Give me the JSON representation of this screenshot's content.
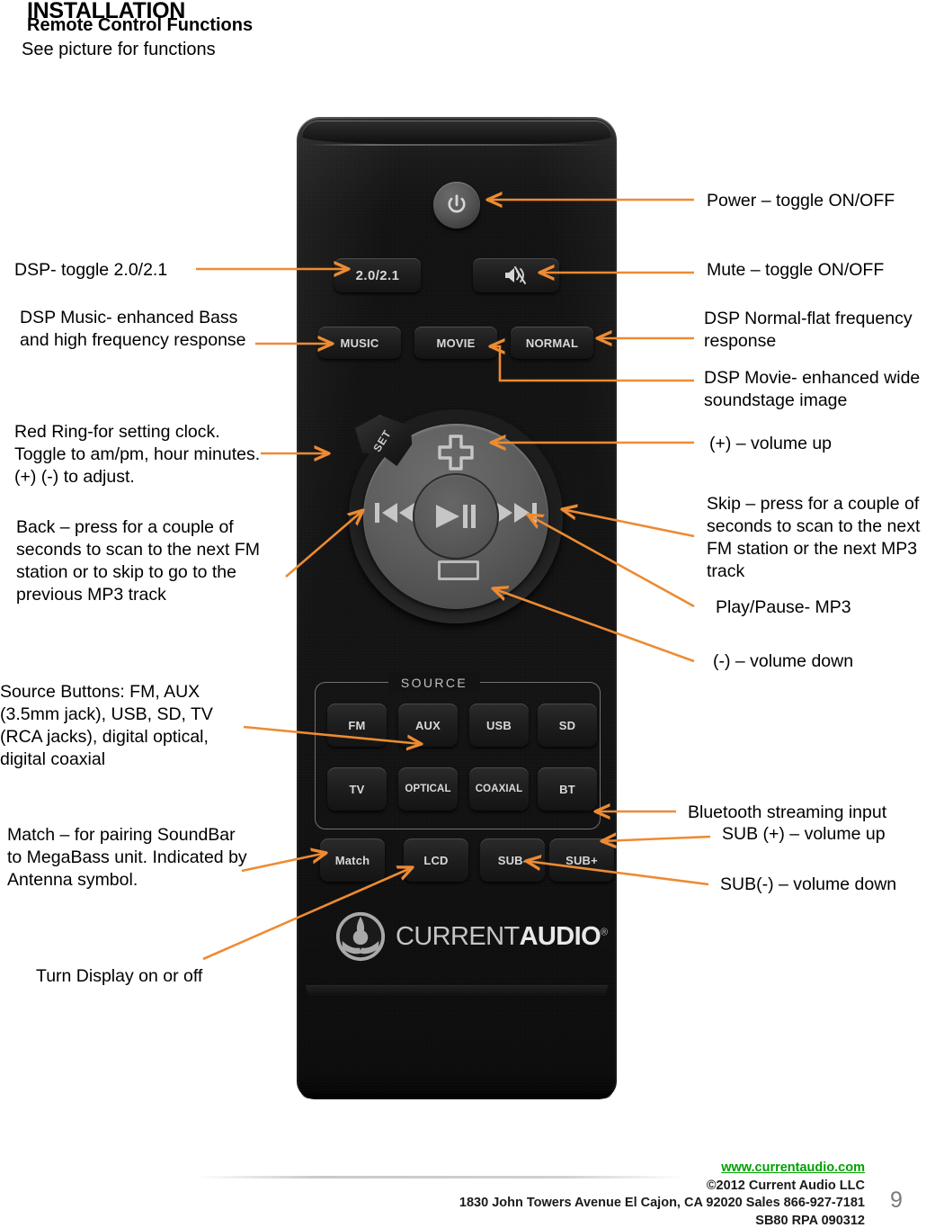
{
  "header": {
    "title": "INSTALLATION",
    "subtitle": "Remote Control Functions",
    "instruction": "See picture for functions"
  },
  "callouts_left": [
    {
      "id": "dsp-toggle",
      "text": "DSP- toggle 2.0/2.1"
    },
    {
      "id": "dsp-music",
      "text": "DSP Music- enhanced Bass and high frequency response"
    },
    {
      "id": "red-ring",
      "text": "Red Ring-for setting clock. Toggle to am/pm, hour minutes. (+) (-) to adjust."
    },
    {
      "id": "back",
      "text": "Back – press for a couple of seconds to scan to the next FM station or to skip to go to the previous MP3 track"
    },
    {
      "id": "source-buttons",
      "text": "Source Buttons: FM, AUX (3.5mm jack), USB, SD, TV (RCA jacks), digital optical, digital coaxial"
    },
    {
      "id": "match",
      "text": "Match – for pairing SoundBar to  MegaBass unit. Indicated by Antenna symbol."
    },
    {
      "id": "lcd",
      "text": "Turn Display on or off"
    }
  ],
  "callouts_right": [
    {
      "id": "power",
      "text": "Power – toggle ON/OFF"
    },
    {
      "id": "mute",
      "text": "Mute – toggle ON/OFF"
    },
    {
      "id": "dsp-normal",
      "text": "DSP Normal-flat frequency response"
    },
    {
      "id": "dsp-movie",
      "text": "DSP Movie- enhanced wide soundstage image"
    },
    {
      "id": "vol-up",
      "text": "(+) – volume up"
    },
    {
      "id": "skip",
      "text": "Skip – press for a couple of seconds to scan to the next FM station or the next MP3 track"
    },
    {
      "id": "play",
      "text": "Play/Pause- MP3"
    },
    {
      "id": "vol-down",
      "text": "(-) – volume down"
    },
    {
      "id": "bluetooth",
      "text": "Bluetooth streaming input"
    },
    {
      "id": "sub-up",
      "text": "SUB (+) – volume up"
    },
    {
      "id": "sub-down",
      "text": "SUB(-) – volume down"
    }
  ],
  "remote": {
    "power_icon": "power-icon",
    "mode_row_a": {
      "dsp_toggle": "2.0/2.1",
      "mute_icon": "mute-icon"
    },
    "dsp_modes": [
      "MUSIC",
      "MOVIE",
      "NORMAL"
    ],
    "dpad": {
      "set_label": "SET",
      "plus_icon": "plus-icon",
      "minus_icon": "minus-icon",
      "prev_icon": "previous-track-icon",
      "next_icon": "next-track-icon",
      "play_pause_icon": "play-pause-icon"
    },
    "source_group_label": "SOURCE",
    "source_buttons_row1": [
      "FM",
      "AUX",
      "USB",
      "SD"
    ],
    "source_buttons_row2": [
      "TV",
      "OPTICAL",
      "COAXIAL",
      "BT"
    ],
    "bottom_buttons": [
      "Match",
      "LCD",
      "SUB-",
      "SUB+"
    ],
    "logo": {
      "light": "CURRENT",
      "bold": "AUDIO",
      "registered": "®"
    }
  },
  "footer": {
    "url": "www.currentaudio.com",
    "copyright": "©2012 Current Audio LLC",
    "address": "1830 John Towers Avenue  El Cajon, CA 92020   Sales 866-927-7181",
    "doc_code": "SB80 RPA 090312",
    "page_number": "9"
  },
  "colors": {
    "arrow": "#ED8B33",
    "link": "#00a000",
    "remote_body": "#141414"
  }
}
